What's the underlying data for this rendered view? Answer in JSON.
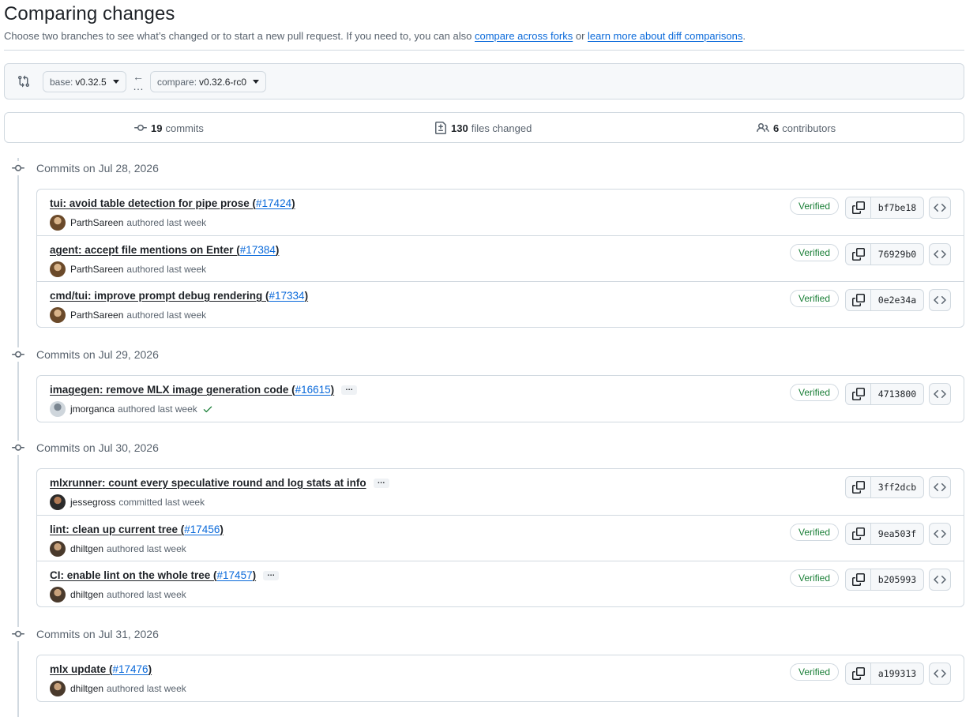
{
  "header": {
    "title": "Comparing changes",
    "subtitle_text": "Choose two branches to see what’s changed or to start a new pull request. If you need to, you can also ",
    "link_forks": "compare across forks",
    "subtitle_or": " or ",
    "link_learn": "learn more about diff comparisons",
    "subtitle_end": "."
  },
  "range": {
    "base_prefix": "base:",
    "base_value": "v0.32.5",
    "compare_prefix": "compare:",
    "compare_value": "v0.32.6-rc0"
  },
  "summary": {
    "commits_count": "19",
    "commits_label": "commits",
    "files_count": "130",
    "files_label": "files changed",
    "contributors_count": "6",
    "contributors_label": "contributors"
  },
  "days": [
    {
      "label": "Commits on Jul 28, 2026",
      "commits": [
        {
          "message": "tui: avoid table detection for pipe prose (",
          "pr": "#17424",
          "close": ")",
          "author": "ParthSareen",
          "action": "authored last week",
          "verified": "Verified",
          "sha": "bf7be18"
        },
        {
          "message": "agent: accept file mentions on Enter (",
          "pr": "#17384",
          "close": ")",
          "author": "ParthSareen",
          "action": "authored last week",
          "verified": "Verified",
          "sha": "76929b0"
        },
        {
          "message": "cmd/tui: improve prompt debug rendering (",
          "pr": "#17334",
          "close": ")",
          "author": "ParthSareen",
          "action": "authored last week",
          "verified": "Verified",
          "sha": "0e2e34a"
        }
      ]
    },
    {
      "label": "Commits on Jul 29, 2026",
      "commits": [
        {
          "message": "imagegen: remove MLX image generation code (",
          "pr": "#16615",
          "close": ")",
          "author": "jmorganca",
          "action": "authored last week",
          "verified": "Verified",
          "sha": "4713800"
        }
      ]
    },
    {
      "label": "Commits on Jul 30, 2026",
      "commits": [
        {
          "message": "mlxrunner: count every speculative round and log stats at info",
          "pr": "",
          "close": "",
          "author": "jessegross",
          "action": "committed last week",
          "verified": "",
          "sha": "3ff2dcb"
        },
        {
          "message": "lint: clean up current tree (",
          "pr": "#17456",
          "close": ")",
          "author": "dhiltgen",
          "action": "authored last week",
          "verified": "Verified",
          "sha": "9ea503f"
        },
        {
          "message": "CI: enable lint on the whole tree (",
          "pr": "#17457",
          "close": ")",
          "author": "dhiltgen",
          "action": "authored last week",
          "verified": "Verified",
          "sha": "b205993"
        }
      ]
    },
    {
      "label": "Commits on Jul 31, 2026",
      "commits": [
        {
          "message": "mlx update (",
          "pr": "#17476",
          "close": ")",
          "author": "dhiltgen",
          "action": "authored last week",
          "verified": "Verified",
          "sha": "a199313"
        }
      ]
    }
  ],
  "colors": {
    "link": "#0969da",
    "verified": "#1a7f37",
    "border": "#d1d9e0",
    "muted": "#59636e"
  }
}
